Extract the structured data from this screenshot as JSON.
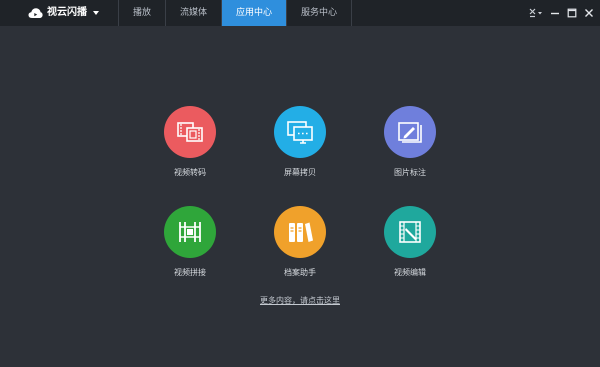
{
  "window": {
    "app_name": "视云闪播"
  },
  "tabs": [
    {
      "label": "播放"
    },
    {
      "label": "流媒体"
    },
    {
      "label": "应用中心"
    },
    {
      "label": "服务中心"
    }
  ],
  "active_tab": "应用中心",
  "apps": [
    {
      "label": "视频转码",
      "icon": "video-convert-icon",
      "color": "#eb5b5f"
    },
    {
      "label": "屏幕拷贝",
      "icon": "screen-copy-icon",
      "color": "#23aee6"
    },
    {
      "label": "图片标注",
      "icon": "image-annotate-icon",
      "color": "#6f7fdc"
    },
    {
      "label": "视频拼接",
      "icon": "video-merge-icon",
      "color": "#2fa63a"
    },
    {
      "label": "档案助手",
      "icon": "archive-assistant-icon",
      "color": "#f0a12b"
    },
    {
      "label": "视频编辑",
      "icon": "video-edit-icon",
      "color": "#1fa89d"
    }
  ],
  "more_link": "更多内容，请点击这里",
  "colors": {
    "titlebar_bg": "#1f2328",
    "window_bg": "#2d3138",
    "active_tab": "#2f8fdd"
  }
}
